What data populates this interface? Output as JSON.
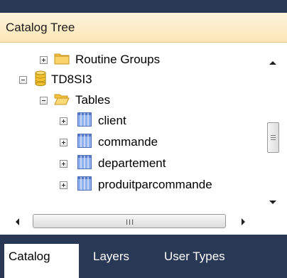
{
  "panel": {
    "title": "Catalog Tree"
  },
  "tree": {
    "nodes": [
      {
        "label": "Routine Groups",
        "expander": "plus",
        "icon": "folder-closed-icon"
      },
      {
        "label": "TD8SI3",
        "expander": "minus",
        "icon": "database-icon"
      },
      {
        "label": "Tables",
        "expander": "minus",
        "icon": "folder-open-icon"
      },
      {
        "label": "client",
        "expander": "plus",
        "icon": "table-icon"
      },
      {
        "label": "commande",
        "expander": "plus",
        "icon": "table-icon"
      },
      {
        "label": "departement",
        "expander": "plus",
        "icon": "table-icon"
      },
      {
        "label": "produitparcommande",
        "expander": "plus",
        "icon": "table-icon"
      }
    ]
  },
  "hscroll": {
    "grip": "III"
  },
  "tabs": [
    {
      "label": "Catalog",
      "active": true
    },
    {
      "label": "Layers",
      "active": false
    },
    {
      "label": "User Types",
      "active": false
    }
  ],
  "colors": {
    "frame": "#293955",
    "header": "#fbe6b6",
    "folder": "#f5c242",
    "database": "#f3c233",
    "table": "#6d8fd8"
  }
}
